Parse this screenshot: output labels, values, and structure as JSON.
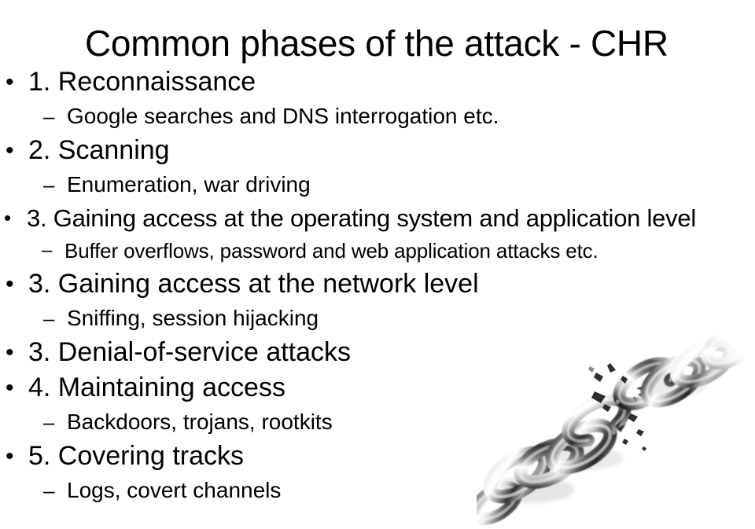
{
  "slide": {
    "title": "Common phases of the attack - CHR",
    "background_color": "#ffffff",
    "text_color": "#000000",
    "bullet_glyph": "•",
    "sub_bullet_glyph": "–",
    "items": [
      {
        "level": 1,
        "marker": "•",
        "text": "1. Reconnaissance"
      },
      {
        "level": 2,
        "marker": "–",
        "text": "Google searches and DNS interrogation etc."
      },
      {
        "level": 1,
        "marker": "•",
        "text": "2. Scanning"
      },
      {
        "level": 2,
        "marker": "–",
        "text": "Enumeration, war driving"
      },
      {
        "level": 1,
        "marker": "•",
        "text": "3. Gaining access at the operating system and application level"
      },
      {
        "level": 2,
        "marker": "–",
        "text": "Buffer overflows, password and web application attacks etc."
      },
      {
        "level": 1,
        "marker": "•",
        "text": "3. Gaining access at the network level"
      },
      {
        "level": 2,
        "marker": "–",
        "text": "Sniffing, session hijacking"
      },
      {
        "level": 1,
        "marker": "•",
        "text": "3. Denial-of-service attacks"
      },
      {
        "level": 1,
        "marker": "•",
        "text": "4. Maintaining access"
      },
      {
        "level": 2,
        "marker": "–",
        "text": "Backdoors, trojans, rootkits"
      },
      {
        "level": 1,
        "marker": "•",
        "text": "5. Covering tracks"
      },
      {
        "level": 2,
        "marker": "–",
        "text": "Logs, covert channels"
      }
    ],
    "image": {
      "name": "broken-chain",
      "description": "Grayscale photograph of a metal chain snapping apart",
      "palette": {
        "dark": "#1a1a1a",
        "mid": "#777777",
        "light": "#d8d8d8",
        "highlight": "#ffffff"
      }
    }
  }
}
